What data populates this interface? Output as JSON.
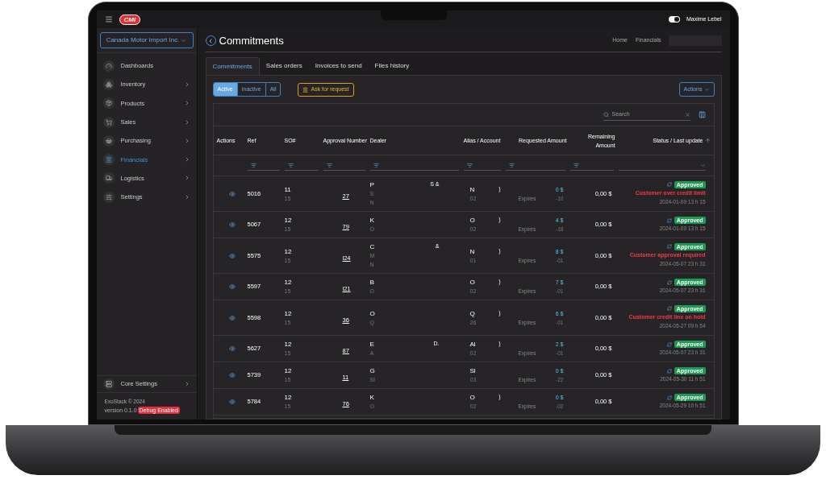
{
  "top_bar": {
    "logo": "CMI",
    "user": "Maxime Lebel",
    "toggle_on": true
  },
  "sidebar": {
    "company": "Canada Motor Import Inc.",
    "items": [
      {
        "label": "Dashboards",
        "kind": "dashboards",
        "expandable": false,
        "selected": false
      },
      {
        "label": "Inventory",
        "kind": "inventory",
        "expandable": true,
        "selected": false
      },
      {
        "label": "Products",
        "kind": "products",
        "expandable": true,
        "selected": false
      },
      {
        "label": "Sales",
        "kind": "sales",
        "expandable": true,
        "selected": false
      },
      {
        "label": "Purchasing",
        "kind": "purchasing",
        "expandable": true,
        "selected": false
      },
      {
        "label": "Financials",
        "kind": "financials",
        "expandable": true,
        "selected": true
      },
      {
        "label": "Logistics",
        "kind": "logistics",
        "expandable": true,
        "selected": false
      },
      {
        "label": "Settings",
        "kind": "settings",
        "expandable": true,
        "selected": false
      }
    ],
    "core_settings": "Core Settings",
    "copyright": "ExoStack © 2024",
    "version": "version 0.1.0",
    "debug_badge": "Debug Enabled"
  },
  "page": {
    "title": "Commitments",
    "breadcrumbs": [
      "Home",
      "Financials"
    ]
  },
  "tabs": [
    {
      "label": "Commitments",
      "selected": true
    },
    {
      "label": "Sales orders",
      "selected": false
    },
    {
      "label": "Invoices to send",
      "selected": false
    },
    {
      "label": "Files history",
      "selected": false
    }
  ],
  "filters": [
    {
      "label": "Active",
      "selected": true
    },
    {
      "label": "Inactive",
      "selected": false
    },
    {
      "label": "All",
      "selected": false
    }
  ],
  "ask_button": "Ask for request",
  "actions_button": "Actions",
  "search": {
    "placeholder": "Search"
  },
  "table": {
    "columns": [
      "Actions",
      "Ref",
      "SO#",
      "Approval Number",
      "Dealer",
      "Alias / Account",
      "Requested Amount",
      "Remaining Amount",
      "Status / Last update"
    ],
    "rows": [
      {
        "ref": "5016",
        "so": [
          "11",
          "15"
        ],
        "approval": "27",
        "dealer": [
          "P",
          "S",
          "N"
        ],
        "dealer_tail": "S &",
        "alias": [
          "N",
          "02"
        ],
        "col_x": ")",
        "expires": "Expires",
        "requested": [
          "0 $",
          "-10"
        ],
        "remaining": "0,00 $",
        "status": "Approved",
        "alert": "Customer over credit limit",
        "updated": "2024-01-09 13 h 15"
      },
      {
        "ref": "5067",
        "so": [
          "12",
          "15"
        ],
        "approval": "79",
        "dealer": [
          "K",
          "O"
        ],
        "alias": [
          "O",
          "02"
        ],
        "col_x": ")",
        "expires": "Expires",
        "requested": [
          "4 $",
          "-18"
        ],
        "remaining": "0,00 $",
        "status": "Approved",
        "updated": "2024-01-09 13 h 15"
      },
      {
        "ref": "5575",
        "so": [
          "12",
          "15"
        ],
        "approval": "l24",
        "dealer": [
          "C",
          "M",
          "N"
        ],
        "dealer_tail": "&",
        "alias": [
          "N",
          "01"
        ],
        "col_x": ")",
        "expires": "Expires",
        "requested": [
          "8 $",
          "-01"
        ],
        "remaining": "0,00 $",
        "status": "Approved",
        "alert": "Customer approval required",
        "updated": "2024-05-07 23 h 31"
      },
      {
        "ref": "5597",
        "so": [
          "12",
          "15"
        ],
        "approval": "l21",
        "dealer": [
          "B",
          "O"
        ],
        "alias": [
          "O",
          "02"
        ],
        "col_x": ")",
        "expires": "Expires",
        "requested": [
          "7 $",
          "-01"
        ],
        "remaining": "0,00 $",
        "status": "Approved",
        "updated": "2024-05-07 23 h 31"
      },
      {
        "ref": "5598",
        "so": [
          "12",
          "15"
        ],
        "approval": "36",
        "dealer": [
          "O",
          "Q"
        ],
        "alias": [
          "Q",
          "26"
        ],
        "col_x": ")",
        "expires": "Expires",
        "requested": [
          "6 $",
          "-01"
        ],
        "remaining": "0,00 $",
        "status": "Approved",
        "alert": "Customer credit line on hold",
        "updated": "2024-05-27 09 h 54"
      },
      {
        "ref": "5627",
        "so": [
          "12",
          "15"
        ],
        "approval": "87",
        "dealer": [
          "E",
          "A"
        ],
        "dealer_tail": "D.",
        "alias": [
          "Al",
          "02"
        ],
        "col_x": ")",
        "expires": "Expires",
        "requested": [
          "2 $",
          "-01"
        ],
        "remaining": "0,00 $",
        "status": "Approved",
        "updated": "2024-05-07 23 h 31"
      },
      {
        "ref": "5739",
        "so": [
          "12",
          "15"
        ],
        "approval": "11",
        "dealer": [
          "G",
          "Sl"
        ],
        "alias": [
          "Sl",
          "03"
        ],
        "expires": "Expires",
        "requested": [
          "0 $",
          "-22"
        ],
        "remaining": "0,00 $",
        "status": "Approved",
        "updated": "2024-05-30 11 h 51"
      },
      {
        "ref": "5784",
        "so": [
          "12",
          "15"
        ],
        "approval": "76",
        "dealer": [
          "K",
          "O"
        ],
        "alias": [
          "O",
          "02"
        ],
        "col_x": ")",
        "expires": "Expires",
        "requested": [
          "0 $",
          "-02"
        ],
        "remaining": "0,00 $",
        "status": "Approved",
        "updated": "2024-05-29 10 h 51"
      }
    ]
  }
}
